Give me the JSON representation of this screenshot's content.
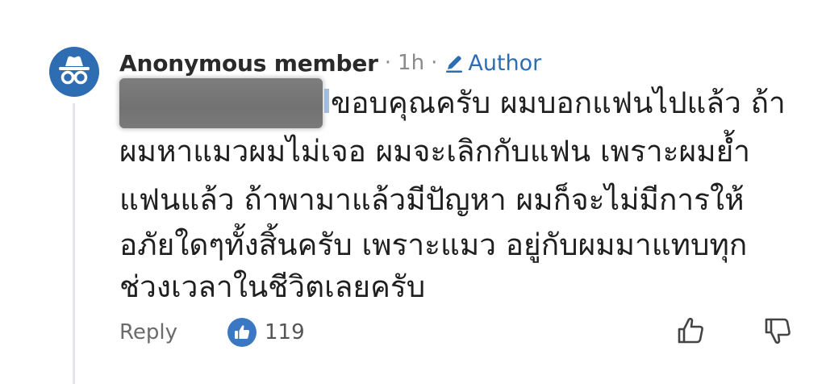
{
  "comment": {
    "avatar_icon": "incognito-icon",
    "author_name": "Anonymous member",
    "separator": "·",
    "time": "1h",
    "badge_icon": "pencil-icon",
    "badge_label": "Author",
    "body_lines": [
      "ขอบคุณครับ ผมบอกแฟนไปแล้ว ถ้า",
      "ผมหาแมวผมไม่เจอ ผมจะเลิกกับแฟน เพราะผมย้ำ",
      "แฟนแล้ว ถ้าพามาแล้วมีปัญหา ผมก็จะไม่มีการให้",
      "อภัยใดๆทั้งสิ้นครับ เพราะแมว อยู่กับผมมาแทบทุก",
      "ช่วงเวลาในชีวิตเลยครับ"
    ],
    "reply_label": "Reply",
    "like_icon": "thumbs-up-icon",
    "like_count": "119",
    "upvote_icon": "thumbs-up-outline-icon",
    "downvote_icon": "thumbs-down-outline-icon"
  },
  "colors": {
    "accent": "#2f6db3",
    "text": "#1f1f1f",
    "muted": "#8a8a8a"
  }
}
